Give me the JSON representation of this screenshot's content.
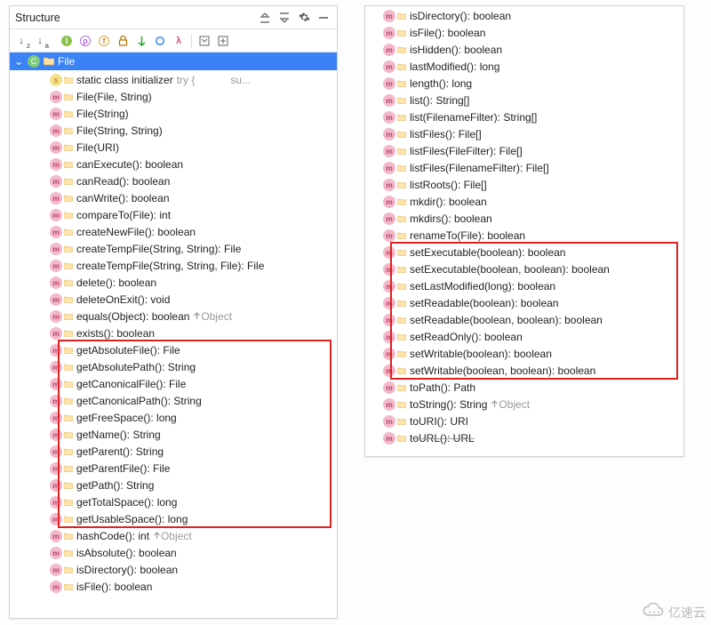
{
  "title": "Structure",
  "class_name": "File",
  "titlebar_icons": [
    "collapse-all",
    "expand-all",
    "gear",
    "minimize"
  ],
  "toolbar_icons": [
    "sort-az",
    "sort-alpha",
    "i",
    "p",
    "f",
    "lock",
    "down",
    "ring",
    "lambda",
    "sep",
    "expand-down",
    "shortcut"
  ],
  "left_items": [
    {
      "kind": "s",
      "label": "static class initializer",
      "hint": "try {",
      "hint2": "su..."
    },
    {
      "kind": "m",
      "label": "File(File, String)"
    },
    {
      "kind": "m",
      "label": "File(String)"
    },
    {
      "kind": "m",
      "label": "File(String, String)"
    },
    {
      "kind": "m",
      "label": "File(URI)"
    },
    {
      "kind": "m",
      "label": "canExecute(): boolean"
    },
    {
      "kind": "m",
      "label": "canRead(): boolean"
    },
    {
      "kind": "m",
      "label": "canWrite(): boolean"
    },
    {
      "kind": "m",
      "label": "compareTo(File): int"
    },
    {
      "kind": "m",
      "label": "createNewFile(): boolean"
    },
    {
      "kind": "m",
      "label": "createTempFile(String, String): File"
    },
    {
      "kind": "m",
      "label": "createTempFile(String, String, File): File"
    },
    {
      "kind": "m",
      "label": "delete(): boolean"
    },
    {
      "kind": "m",
      "label": "deleteOnExit(): void"
    },
    {
      "kind": "m",
      "label": "equals(Object): boolean",
      "override": "Object"
    },
    {
      "kind": "m",
      "label": "exists(): boolean"
    },
    {
      "kind": "m",
      "label": "getAbsoluteFile(): File",
      "hl": true
    },
    {
      "kind": "m",
      "label": "getAbsolutePath(): String",
      "hl": true
    },
    {
      "kind": "m",
      "label": "getCanonicalFile(): File",
      "hl": true
    },
    {
      "kind": "m",
      "label": "getCanonicalPath(): String",
      "hl": true
    },
    {
      "kind": "m",
      "label": "getFreeSpace(): long",
      "hl": true
    },
    {
      "kind": "m",
      "label": "getName(): String",
      "hl": true
    },
    {
      "kind": "m",
      "label": "getParent(): String",
      "hl": true
    },
    {
      "kind": "m",
      "label": "getParentFile(): File",
      "hl": true
    },
    {
      "kind": "m",
      "label": "getPath(): String",
      "hl": true
    },
    {
      "kind": "m",
      "label": "getTotalSpace(): long",
      "hl": true
    },
    {
      "kind": "m",
      "label": "getUsableSpace(): long",
      "hl": true
    },
    {
      "kind": "m",
      "label": "hashCode(): int",
      "override": "Object"
    },
    {
      "kind": "m",
      "label": "isAbsolute(): boolean"
    },
    {
      "kind": "m",
      "label": "isDirectory(): boolean"
    },
    {
      "kind": "m",
      "label": "isFile(): boolean"
    }
  ],
  "right_items": [
    {
      "kind": "m",
      "label": "isDirectory(): boolean"
    },
    {
      "kind": "m",
      "label": "isFile(): boolean"
    },
    {
      "kind": "m",
      "label": "isHidden(): boolean"
    },
    {
      "kind": "m",
      "label": "lastModified(): long"
    },
    {
      "kind": "m",
      "label": "length(): long"
    },
    {
      "kind": "m",
      "label": "list(): String[]"
    },
    {
      "kind": "m",
      "label": "list(FilenameFilter): String[]"
    },
    {
      "kind": "m",
      "label": "listFiles(): File[]"
    },
    {
      "kind": "m",
      "label": "listFiles(FileFilter): File[]"
    },
    {
      "kind": "m",
      "label": "listFiles(FilenameFilter): File[]"
    },
    {
      "kind": "m",
      "label": "listRoots(): File[]"
    },
    {
      "kind": "m",
      "label": "mkdir(): boolean"
    },
    {
      "kind": "m",
      "label": "mkdirs(): boolean"
    },
    {
      "kind": "m",
      "label": "renameTo(File): boolean"
    },
    {
      "kind": "m",
      "label": "setExecutable(boolean): boolean",
      "hl": true
    },
    {
      "kind": "m",
      "label": "setExecutable(boolean, boolean): boolean",
      "hl": true
    },
    {
      "kind": "m",
      "label": "setLastModified(long): boolean",
      "hl": true
    },
    {
      "kind": "m",
      "label": "setReadable(boolean): boolean",
      "hl": true
    },
    {
      "kind": "m",
      "label": "setReadable(boolean, boolean): boolean",
      "hl": true
    },
    {
      "kind": "m",
      "label": "setReadOnly(): boolean",
      "hl": true
    },
    {
      "kind": "m",
      "label": "setWritable(boolean): boolean",
      "hl": true
    },
    {
      "kind": "m",
      "label": "setWritable(boolean, boolean): boolean",
      "hl": true
    },
    {
      "kind": "m",
      "label": "toPath(): Path"
    },
    {
      "kind": "m",
      "label": "toString(): String",
      "override": "Object"
    },
    {
      "kind": "m",
      "label": "toURI(): URI"
    },
    {
      "kind": "m",
      "label": "toURL(): URL",
      "strike": true
    }
  ],
  "watermark": "亿速云"
}
